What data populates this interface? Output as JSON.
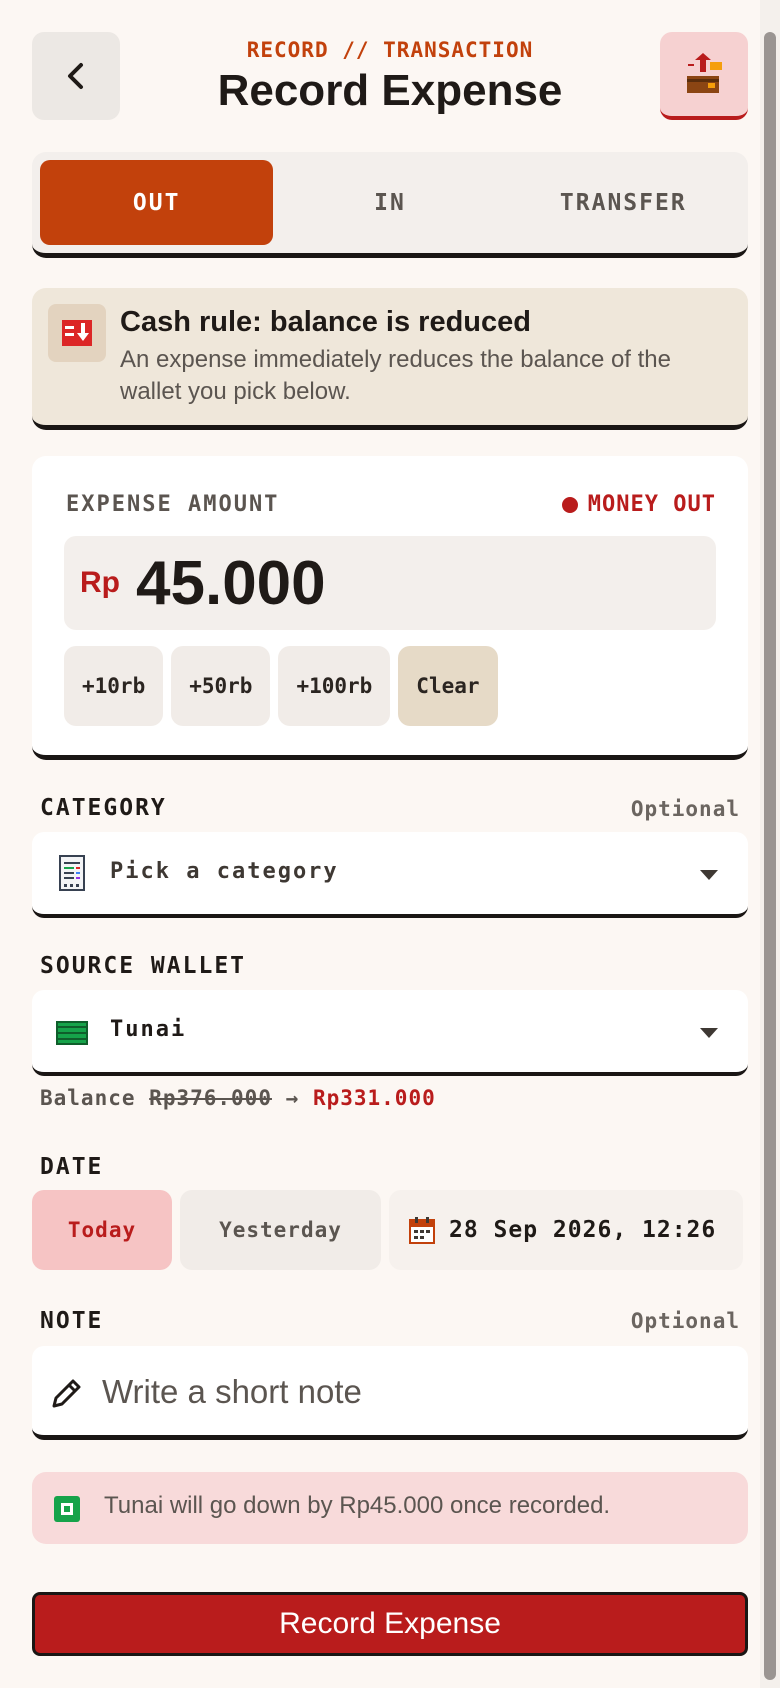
{
  "header": {
    "eyebrow": "RECORD // TRANSACTION",
    "title": "Record Expense",
    "back_icon": "chevron-left-icon",
    "corner_icon": "wallet-out-icon"
  },
  "tabs": [
    {
      "label": "OUT",
      "active": true
    },
    {
      "label": "IN",
      "active": false
    },
    {
      "label": "TRANSFER",
      "active": false
    }
  ],
  "rule": {
    "title": "Cash rule: balance is reduced",
    "description": "An expense immediately reduces the balance of the wallet you pick below."
  },
  "amount": {
    "label": "EXPENSE AMOUNT",
    "status": "MONEY OUT",
    "currency": "Rp",
    "value": "45.000",
    "quick_add": [
      "+10rb",
      "+50rb",
      "+100rb"
    ],
    "clear_label": "Clear"
  },
  "category": {
    "label": "CATEGORY",
    "optional": "Optional",
    "placeholder": "Pick a category"
  },
  "wallet": {
    "label": "SOURCE WALLET",
    "value": "Tunai",
    "balance_label": "Balance",
    "balance_old": "Rp376.000",
    "arrow": "→",
    "balance_new": "Rp331.000"
  },
  "date": {
    "label": "DATE",
    "today": "Today",
    "yesterday": "Yesterday",
    "value": "28 Sep 2026, 12:26"
  },
  "note": {
    "label": "NOTE",
    "optional": "Optional",
    "placeholder": "Write a short note"
  },
  "hint": "Tunai will go down by Rp45.000 once recorded.",
  "submit_label": "Record Expense",
  "colors": {
    "accent": "#c2410c",
    "danger": "#b91c1c",
    "background": "#fcf7f3"
  }
}
